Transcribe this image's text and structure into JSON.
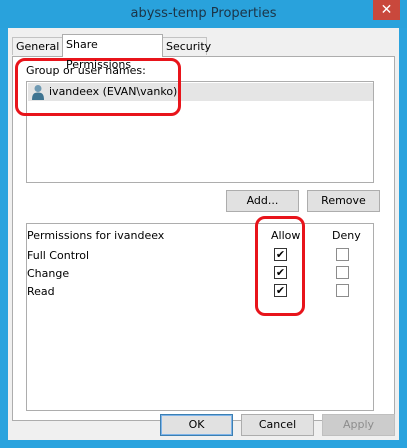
{
  "window": {
    "title": "abyss-temp Properties",
    "close_glyph": "✕"
  },
  "tabs": [
    {
      "label": "General",
      "active": false
    },
    {
      "label": "Share Permissions",
      "active": true
    },
    {
      "label": "Security",
      "active": false
    }
  ],
  "group": {
    "label": "Group or user names:",
    "users": [
      {
        "name": "ivandeex (EVAN\\vanko)",
        "icon": "user-icon",
        "selected": true
      }
    ]
  },
  "buttons": {
    "add": "Add...",
    "remove": "Remove",
    "ok": "OK",
    "cancel": "Cancel",
    "apply": "Apply"
  },
  "permissions": {
    "header": "Permissions for ivandeex",
    "allow_header": "Allow",
    "deny_header": "Deny",
    "rows": [
      {
        "name": "Full Control",
        "allow": true,
        "deny": false
      },
      {
        "name": "Change",
        "allow": true,
        "deny": false
      },
      {
        "name": "Read",
        "allow": true,
        "deny": false
      }
    ]
  },
  "colors": {
    "title_bar": "#29a2dc",
    "close_button": "#c9483c",
    "highlight": "#e8141b"
  }
}
